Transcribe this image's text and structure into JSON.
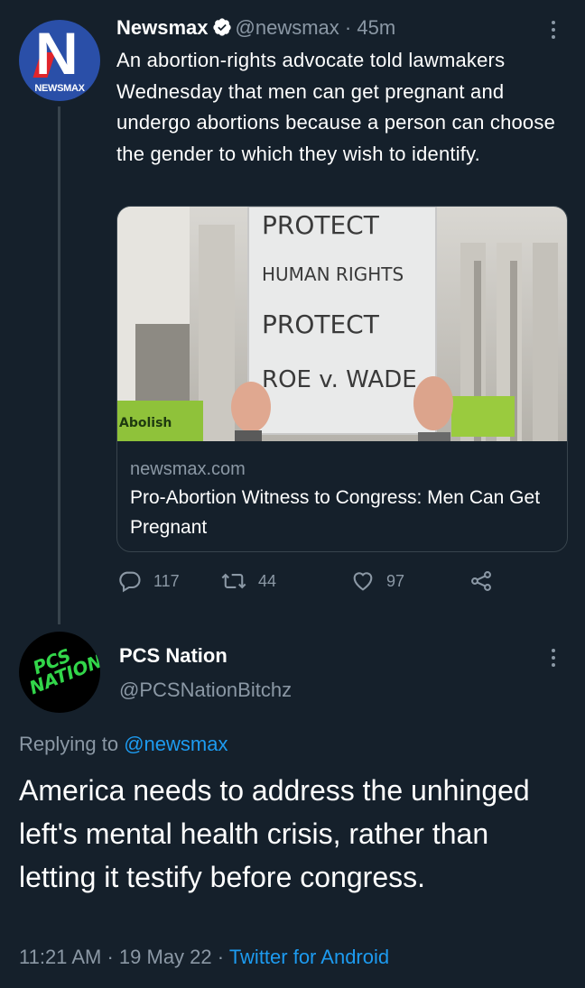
{
  "tweet1": {
    "author_name": "Newsmax",
    "handle": "@newsmax",
    "separator": "·",
    "time": "45m",
    "avatar_text": "NEWSMAX",
    "avatar_letter": "N",
    "text": "An abortion-rights advocate told lawmakers Wednesday that men can get pregnant and undergo abortions because a person can choose the gender to which they wish to identify.",
    "card": {
      "sign_lines": [
        "PROTECT",
        "HUMAN RIGHTS",
        "PROTECT",
        "ROE v. WADE"
      ],
      "green_sign_text": "Abolish",
      "domain": "newsmax.com",
      "title": "Pro-Abortion Witness to Congress: Men Can Get Pregnant"
    },
    "actions": {
      "replies": "117",
      "retweets": "44",
      "likes": "97"
    }
  },
  "tweet2": {
    "author_name": "PCS Nation",
    "handle": "@PCSNationBitchz",
    "avatar_lines": [
      "PCS",
      "NATION"
    ],
    "replying_prefix": "Replying to",
    "replying_to": "@newsmax",
    "text": "America needs to address the unhinged left's mental health crisis, rather than letting it testify before congress.",
    "time": "11:21 AM",
    "date": "19 May 22",
    "separator": "·",
    "source": "Twitter for Android"
  },
  "colors": {
    "background": "#15202b",
    "secondary_text": "#8b98a5",
    "link": "#1d9bf0",
    "border": "#38444d",
    "newsmax_blue": "#2a4fa8",
    "newsmax_red": "#e0242b",
    "pcs_green": "#32d64a"
  },
  "icons": [
    "verified-badge-icon",
    "more-options-icon",
    "reply-icon",
    "retweet-icon",
    "like-icon",
    "share-icon"
  ]
}
